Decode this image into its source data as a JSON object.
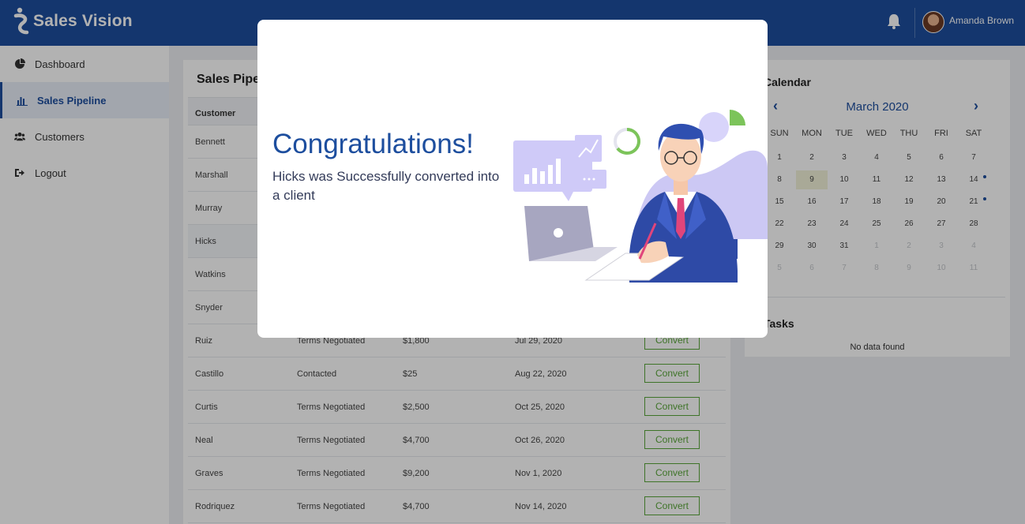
{
  "app": {
    "brand": "Sales Vision",
    "user_name": "Amanda Brown"
  },
  "colors": {
    "primary": "#1d4e9e",
    "convert_green": "#5aa63a",
    "today_highlight": "#f2f3d8"
  },
  "sidebar": {
    "items": [
      {
        "label": "Dashboard",
        "icon": "pie-chart-icon",
        "active": false
      },
      {
        "label": "Sales Pipeline",
        "icon": "bar-chart-icon",
        "active": true
      },
      {
        "label": "Customers",
        "icon": "users-icon",
        "active": false
      },
      {
        "label": "Logout",
        "icon": "logout-icon",
        "active": false
      }
    ]
  },
  "pipeline": {
    "title": "Sales Pipe",
    "columns": [
      "Customer"
    ],
    "convert_label": "Convert",
    "rows": [
      {
        "customer": "Bennett",
        "stage": "",
        "amount": "",
        "date": ""
      },
      {
        "customer": "Marshall",
        "stage": "",
        "amount": "",
        "date": ""
      },
      {
        "customer": "Murray",
        "stage": "",
        "amount": "",
        "date": ""
      },
      {
        "customer": "Hicks",
        "stage": "",
        "amount": "",
        "date": ""
      },
      {
        "customer": "Watkins",
        "stage": "",
        "amount": "",
        "date": ""
      },
      {
        "customer": "Snyder",
        "stage": "",
        "amount": "",
        "date": ""
      },
      {
        "customer": "Ruiz",
        "stage": "Terms Negotiated",
        "amount": "$1,800",
        "date": "Jul 29, 2020"
      },
      {
        "customer": "Castillo",
        "stage": "Contacted",
        "amount": "$25",
        "date": "Aug 22, 2020"
      },
      {
        "customer": "Curtis",
        "stage": "Terms Negotiated",
        "amount": "$2,500",
        "date": "Oct 25, 2020"
      },
      {
        "customer": "Neal",
        "stage": "Terms Negotiated",
        "amount": "$4,700",
        "date": "Oct 26, 2020"
      },
      {
        "customer": "Graves",
        "stage": "Terms Negotiated",
        "amount": "$9,200",
        "date": "Nov 1, 2020"
      },
      {
        "customer": "Rodriquez",
        "stage": "Terms Negotiated",
        "amount": "$4,700",
        "date": "Nov 14, 2020"
      }
    ]
  },
  "calendar": {
    "title": "Calendar",
    "month_label": "March 2020",
    "prev_label": "‹",
    "next_label": "›",
    "weekdays": [
      "SUN",
      "MON",
      "TUE",
      "WED",
      "THU",
      "FRI",
      "SAT"
    ],
    "weeks": [
      [
        "1",
        "2",
        "3",
        "4",
        "5",
        "6",
        "7"
      ],
      [
        "8",
        "9",
        "10",
        "11",
        "12",
        "13",
        "14"
      ],
      [
        "15",
        "16",
        "17",
        "18",
        "19",
        "20",
        "21"
      ],
      [
        "22",
        "23",
        "24",
        "25",
        "26",
        "27",
        "28"
      ],
      [
        "29",
        "30",
        "31",
        "1",
        "2",
        "3",
        "4"
      ],
      [
        "5",
        "6",
        "7",
        "8",
        "9",
        "10",
        "11"
      ]
    ],
    "today": "9",
    "event_days": [
      "14",
      "21"
    ]
  },
  "tasks": {
    "title": "Tasks",
    "empty_text": "No data found"
  },
  "modal": {
    "title": "Congratulations!",
    "message": "Hicks was Successfully converted into a client"
  }
}
